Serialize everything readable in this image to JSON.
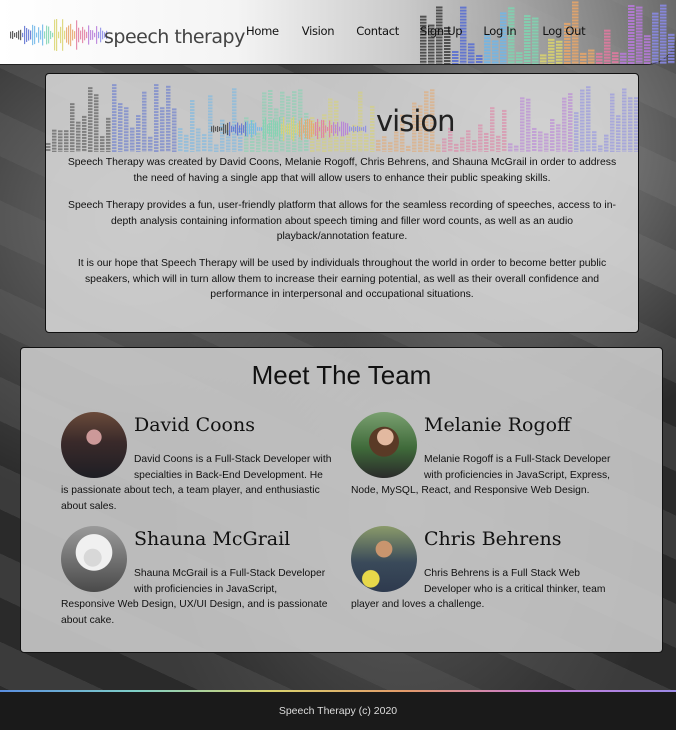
{
  "header": {
    "logo_text": "speech therapy",
    "nav": [
      "Home",
      "Vision",
      "Contact",
      "Sign Up",
      "Log In",
      "Log Out"
    ]
  },
  "vision": {
    "title": "vision",
    "paragraphs": [
      "Speech Therapy was created by David Coons, Melanie Rogoff, Chris Behrens, and Shauna McGrail in order to address the need of having a single app that will allow users to enhance their public speaking skills.",
      "Speech Therapy provides a fun, user-friendly platform that allows for the seamless recording of speeches, access to in-depth analysis containing information about speech timing and filler word counts, as well as an audio playback/annotation feature.",
      "It is our hope that Speech Therapy will be used by individuals throughout the world in order to become better public speakers, which will in turn allow them to increase their earning potential, as well as their overall confidence and performance in interpersonal and occupational situations."
    ]
  },
  "team": {
    "title": "Meet The Team",
    "members": [
      {
        "name": "David Coons",
        "bio": "David Coons is a Full-Stack Developer with specialties in Back-End Development. He is passionate about tech, a team player, and enthusiastic about sales."
      },
      {
        "name": "Melanie Rogoff",
        "bio": "Melanie Rogoff is a Full-Stack Developer with proficiencies in JavaScript, Express, Node, MySQL, React, and Responsive Web Design."
      },
      {
        "name": "Shauna McGrail",
        "bio": "Shauna McGrail is a Full-Stack Developer with proficiencies in JavaScript, Responsive Web Design, UX/UI Design, and is passionate about cake."
      },
      {
        "name": "Chris Behrens",
        "bio": "Chris Behrens is a Full Stack Web Developer who is a critical thinker, team player and loves a challenge."
      }
    ]
  },
  "footer": {
    "text": "Speech Therapy (c) 2020"
  },
  "colors": {
    "wave": [
      "#444444",
      "#5a6fd0",
      "#6fb6e8",
      "#7fd3b0",
      "#d9d36e",
      "#e6a56a",
      "#e07aa0",
      "#b67ad8",
      "#8a8ae6"
    ]
  }
}
